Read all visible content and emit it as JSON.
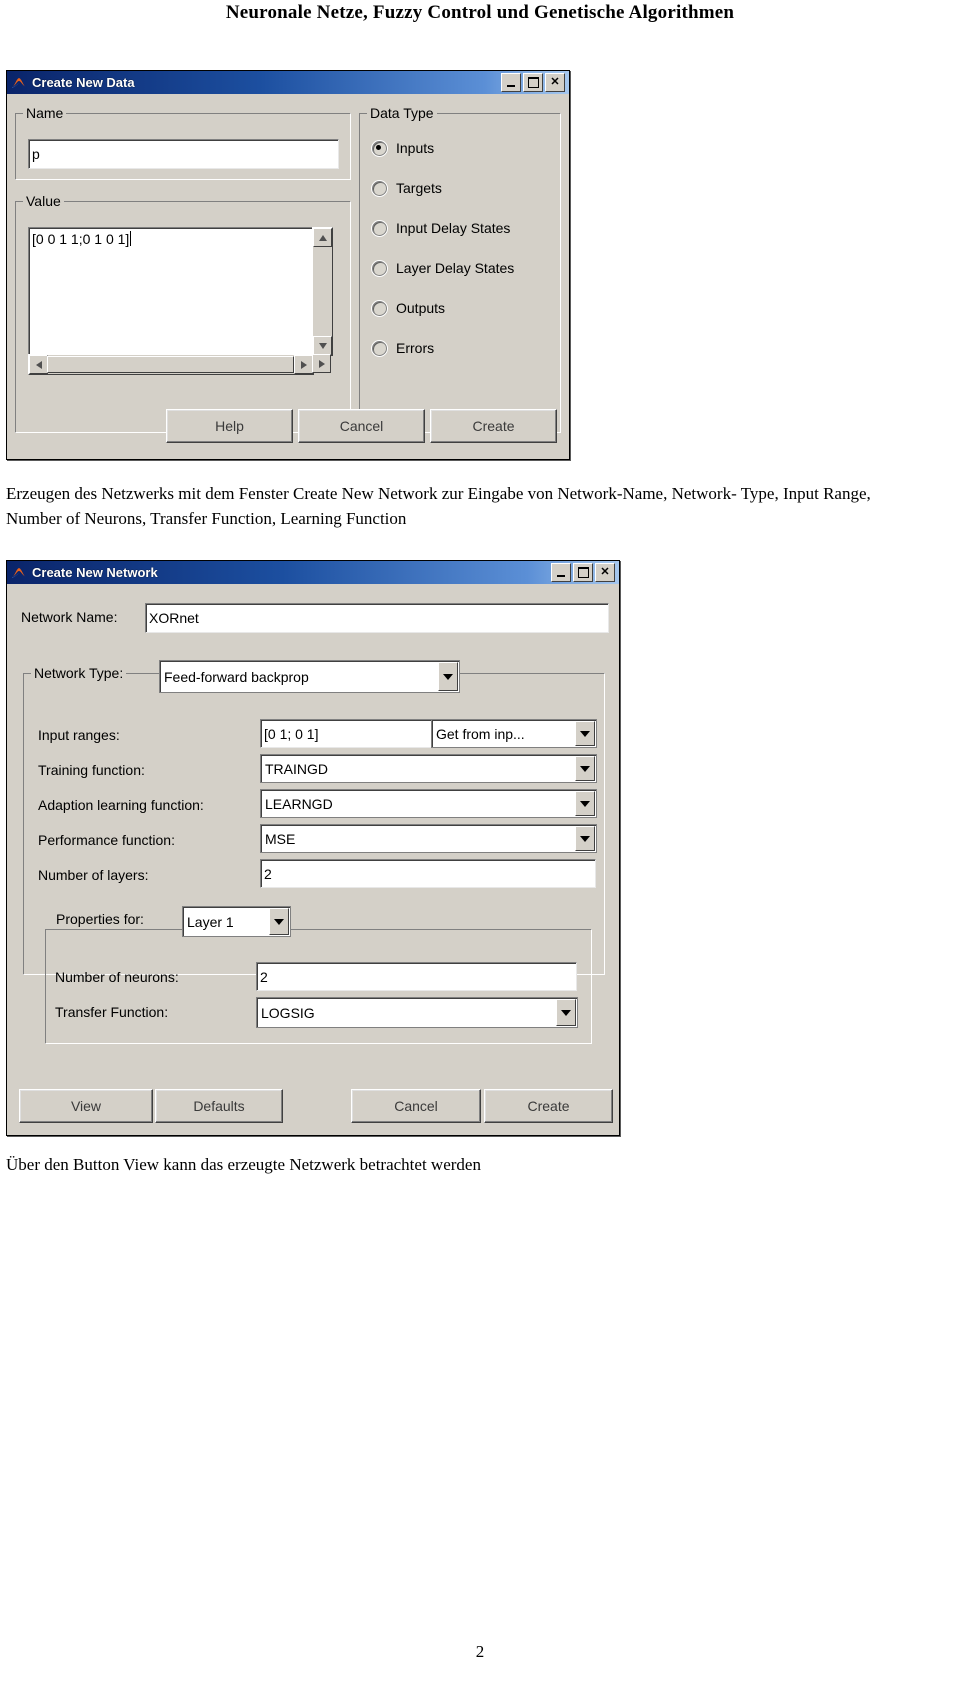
{
  "document": {
    "header_title": "Neuronale Netze, Fuzzy Control und Genetische Algorithmen",
    "page_number": "2",
    "caption_1_line1": "Erzeugen des Netzwerks mit dem Fenster Create New Network zur Eingabe von Network-Name, Network-",
    "caption_1_line2": "Type, Input Range, Number of Neurons, Transfer Function, Learning Function",
    "caption_2": "Über den Button View kann das erzeugte Netzwerk betrachtet werden"
  },
  "create_new_data": {
    "title": "Create New Data",
    "icon": "matlab-membrane-icon",
    "window_buttons": {
      "minimize": "minimize-icon",
      "maximize": "maximize-icon",
      "close": "close-icon"
    },
    "name_group_label": "Name",
    "name_value": "p",
    "value_group_label": "Value",
    "value_text": "[0 0 1 1;0 1 0 1]",
    "data_type_group_label": "Data Type",
    "data_type_options": [
      {
        "label": "Inputs",
        "selected": true
      },
      {
        "label": "Targets",
        "selected": false
      },
      {
        "label": "Input Delay States",
        "selected": false
      },
      {
        "label": "Layer Delay States",
        "selected": false
      },
      {
        "label": "Outputs",
        "selected": false
      },
      {
        "label": "Errors",
        "selected": false
      }
    ],
    "buttons": {
      "help": "Help",
      "cancel": "Cancel",
      "create": "Create"
    }
  },
  "create_new_network": {
    "title": "Create New Network",
    "icon": "matlab-membrane-icon",
    "window_buttons": {
      "minimize": "minimize-icon",
      "maximize": "maximize-icon",
      "close": "close-icon"
    },
    "network_name_label": "Network Name:",
    "network_name_value": "XORnet",
    "network_type_label": "Network Type:",
    "network_type_value": "Feed-forward backprop",
    "fields": [
      {
        "label": "Input ranges:",
        "value": "[0 1; 0 1]"
      },
      {
        "label": "Training function:",
        "value": "TRAINGD"
      },
      {
        "label": "Adaption learning function:",
        "value": "LEARNGD"
      },
      {
        "label": "Performance function:",
        "value": "MSE"
      },
      {
        "label": "Number of layers:",
        "value": "2"
      }
    ],
    "input_ranges_source": "Get from inp...",
    "properties_for_label": "Properties for:",
    "properties_for_value": "Layer 1",
    "layer_fields": [
      {
        "label": "Number of neurons:",
        "value": "2"
      },
      {
        "label": "Transfer Function:",
        "value": "LOGSIG"
      }
    ],
    "buttons": {
      "view": "View",
      "defaults": "Defaults",
      "cancel": "Cancel",
      "create": "Create"
    }
  }
}
